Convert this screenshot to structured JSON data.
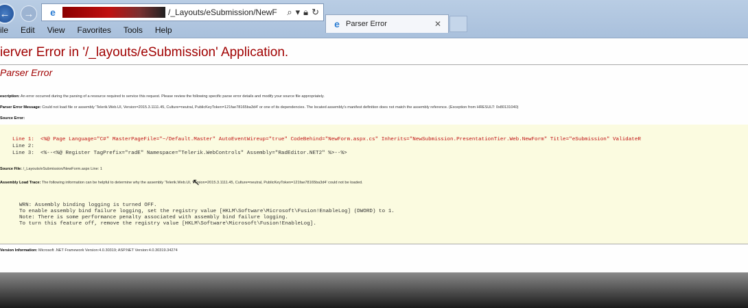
{
  "browser": {
    "url_text": "/_Layouts/eSubmission/NewF",
    "tab_label": "Parser Error",
    "menu": [
      "ile",
      "Edit",
      "View",
      "Favorites",
      "Tools",
      "Help"
    ]
  },
  "page": {
    "title": "ierver Error in '/_layouts/eSubmission' Application.",
    "subtitle": "Parser Error",
    "description_label": "escription:",
    "description_text": "An error occurred during the parsing of a resource required to service this request. Please review the following specific parse error details and modify your source file appropriately.",
    "parser_message_label": "Parser Error Message:",
    "parser_message_text": "Could not load file or assembly 'Telerik.Web.UI, Version=2015.3.1111.45, Culture=neutral, PublicKeyToken=121fae78165ba3d4' or one of its dependencies. The located assembly's manifest definition does not match the assembly reference. (Exception from HRESULT: 0x80131040)",
    "source_error_label": "Source Error:",
    "source_lines": [
      "Line 1:  <%@ Page Language=\"C#\" MasterPageFile=\"~/Default.Master\" AutoEventWireup=\"true\" CodeBehind=\"NewForm.aspx.cs\" Inherits=\"NewSubmission.PresentationTier.Web.NewForm\" Title=\"eSubmission\" ValidateR",
      "Line 2:",
      "Line 3:  <%--<%@ Register TagPrefix=\"radE\" Namespace=\"Telerik.WebControls\" Assembly=\"RadEditor.NET2\" %>--%>"
    ],
    "source_file_label": "Source File:",
    "source_file_text": "/_Layouts/eSubmission/NewForm.aspx    Line: 1",
    "trace_label": "Assembly Load Trace:",
    "trace_text": "The following information can be helpful to determine why the assembly 'Telerik.Web.UI, Version=2015.3.1111.45, Culture=neutral, PublicKeyToken=121fae78165ba3d4' could not be loaded.",
    "trace_lines": [
      "WRN: Assembly binding logging is turned OFF.",
      "To enable assembly bind failure logging, set the registry value [HKLM\\Software\\Microsoft\\Fusion!EnableLog] (DWORD) to 1.",
      "Note: There is some performance penalty associated with assembly bind failure logging.",
      "To turn this feature off, remove the registry value [HKLM\\Software\\Microsoft\\Fusion!EnableLog]."
    ],
    "version_label": "Version Information:",
    "version_text": "Microsoft .NET Framework Version:4.0.30319; ASP.NET Version:4.0.30319.34274"
  },
  "colors": {
    "error_red": "#a00000",
    "code_bg": "#fbfbe0"
  }
}
